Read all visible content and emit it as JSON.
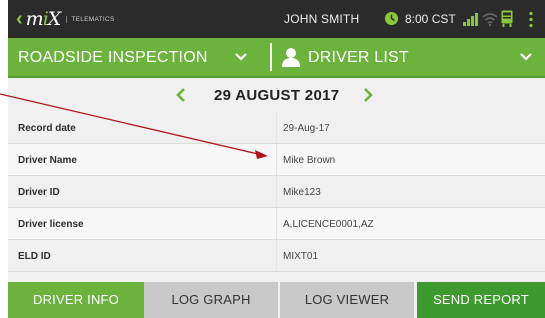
{
  "status_bar": {
    "logo_text": "mix",
    "logo_subtext": "TELEMATICS",
    "user": "JOHN SMITH",
    "time": "8:00 CST"
  },
  "top_nav": {
    "left_label": "ROADSIDE INSPECTION",
    "right_label": "DRIVER LIST"
  },
  "date_nav": {
    "date": "29 AUGUST 2017"
  },
  "table": {
    "rows": [
      {
        "label": "Record date",
        "value": "29-Aug-17"
      },
      {
        "label": "Driver Name",
        "value": "Mike Brown"
      },
      {
        "label": "Driver ID",
        "value": "Mike123"
      },
      {
        "label": "Driver license",
        "value": "A,LICENCE0001,AZ"
      },
      {
        "label": "ELD ID",
        "value": "MIXT01"
      }
    ]
  },
  "bottom_tabs": {
    "driver_info": "DRIVER INFO",
    "log_graph": "LOG GRAPH",
    "log_viewer": "LOG VIEWER",
    "send_report": "SEND REPORT"
  },
  "colors": {
    "brand_green": "#6cb33e",
    "dark_green": "#3e9a2f",
    "status_bar": "#2b2b2b",
    "annotation_red": "#b0121a"
  },
  "icons": [
    "clock-icon",
    "signal-icon",
    "wifi-icon",
    "device-icon",
    "kebab-menu-icon",
    "chevron-down-icon",
    "person-icon",
    "chevron-left-icon",
    "chevron-right-icon"
  ]
}
